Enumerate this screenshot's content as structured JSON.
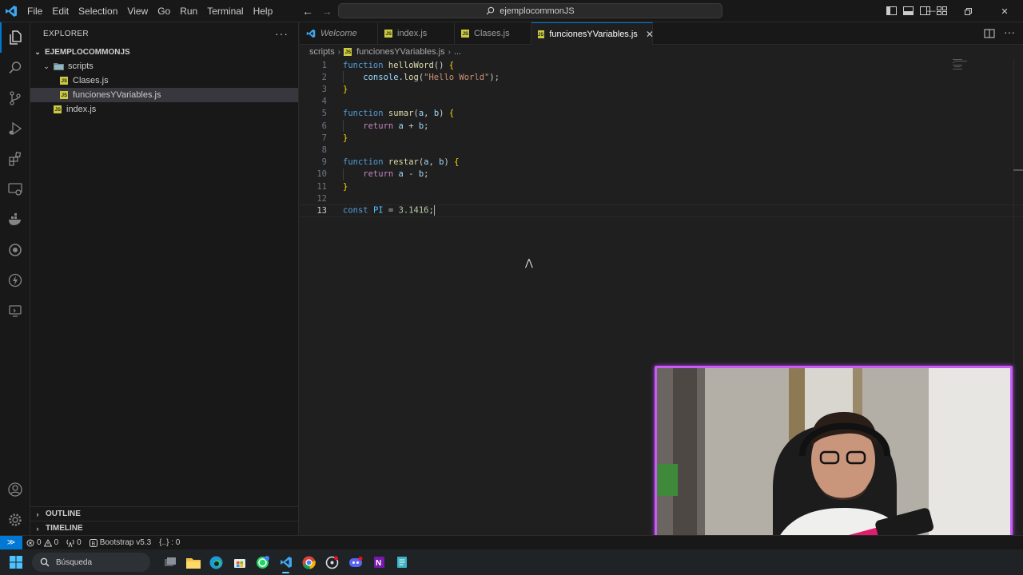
{
  "titlebar": {
    "menu": [
      "File",
      "Edit",
      "Selection",
      "View",
      "Go",
      "Run",
      "Terminal",
      "Help"
    ],
    "search_text": "ejemplocommonJS"
  },
  "sidebar": {
    "title": "EXPLORER",
    "root": "EJEMPLOCOMMONJS",
    "folder": "scripts",
    "files": [
      {
        "name": "Clases.js"
      },
      {
        "name": "funcionesYVariables.js"
      },
      {
        "name": "index.js"
      }
    ],
    "outline": "OUTLINE",
    "timeline": "TIMELINE"
  },
  "tabs": [
    {
      "label": "Welcome"
    },
    {
      "label": "index.js"
    },
    {
      "label": "Clases.js"
    },
    {
      "label": "funcionesYVariables.js"
    }
  ],
  "breadcrumb": {
    "folder": "scripts",
    "file": "funcionesYVariables.js",
    "more": "..."
  },
  "editor": {
    "line_numbers": [
      "1",
      "2",
      "3",
      "4",
      "5",
      "6",
      "7",
      "8",
      "9",
      "10",
      "11",
      "12",
      "13"
    ],
    "current_line": 13,
    "lines": [
      [
        {
          "t": "function ",
          "c": "kw"
        },
        {
          "t": "helloWord",
          "c": "fn"
        },
        {
          "t": "() ",
          "c": ""
        },
        {
          "t": "{",
          "c": "br1"
        }
      ],
      [
        {
          "t": "    console.",
          "c": "var"
        },
        {
          "t": "log",
          "c": "fn"
        },
        {
          "t": "(",
          "c": ""
        },
        {
          "t": "\"Hello World\"",
          "c": "str"
        },
        {
          "t": ");",
          "c": ""
        }
      ],
      [
        {
          "t": "}",
          "c": "br1"
        }
      ],
      [],
      [
        {
          "t": "function ",
          "c": "kw"
        },
        {
          "t": "sumar",
          "c": "fn"
        },
        {
          "t": "(",
          "c": ""
        },
        {
          "t": "a",
          "c": "var"
        },
        {
          "t": ", ",
          "c": ""
        },
        {
          "t": "b",
          "c": "var"
        },
        {
          "t": ") ",
          "c": ""
        },
        {
          "t": "{",
          "c": "br1"
        }
      ],
      [
        {
          "t": "    return ",
          "c": "kw2"
        },
        {
          "t": "a",
          "c": "var"
        },
        {
          "t": " + ",
          "c": ""
        },
        {
          "t": "b",
          "c": "var"
        },
        {
          "t": ";",
          "c": ""
        }
      ],
      [
        {
          "t": "}",
          "c": "br1"
        }
      ],
      [],
      [
        {
          "t": "function ",
          "c": "kw"
        },
        {
          "t": "restar",
          "c": "fn"
        },
        {
          "t": "(",
          "c": ""
        },
        {
          "t": "a",
          "c": "var"
        },
        {
          "t": ", ",
          "c": ""
        },
        {
          "t": "b",
          "c": "var"
        },
        {
          "t": ") ",
          "c": ""
        },
        {
          "t": "{",
          "c": "br1"
        }
      ],
      [
        {
          "t": "    return ",
          "c": "kw2"
        },
        {
          "t": "a",
          "c": "var"
        },
        {
          "t": " - ",
          "c": ""
        },
        {
          "t": "b",
          "c": "var"
        },
        {
          "t": ";",
          "c": ""
        }
      ],
      [
        {
          "t": "}",
          "c": "br1"
        }
      ],
      [],
      [
        {
          "t": "const ",
          "c": "kw"
        },
        {
          "t": "PI",
          "c": "cnst"
        },
        {
          "t": " = ",
          "c": ""
        },
        {
          "t": "3.1416",
          "c": "num"
        },
        {
          "t": ";",
          "c": ""
        }
      ]
    ]
  },
  "statusbar": {
    "errors": "0",
    "warnings": "0",
    "ports": "0",
    "bootstrap": "Bootstrap v5.3",
    "sel": "{..} : 0"
  },
  "taskbar": {
    "search_label": "Búsqueda"
  },
  "colors": {
    "accent": "#0078d4",
    "webcam_border": "#c85cf5",
    "js_badge": "#cbcb41"
  }
}
